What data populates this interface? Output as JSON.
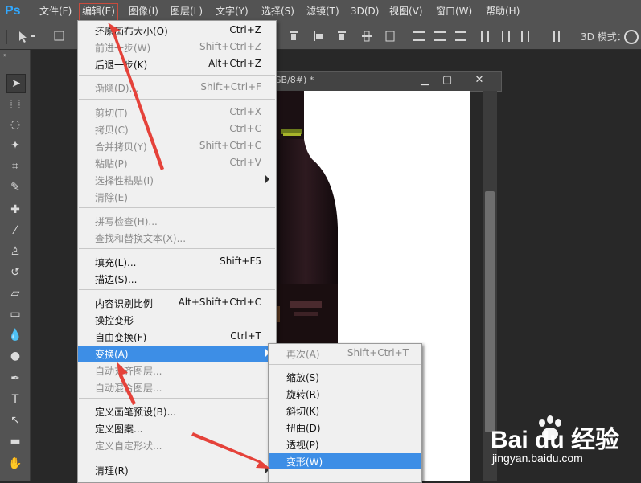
{
  "app": {
    "logo": "Ps"
  },
  "menubar": [
    {
      "label": "文件(F)"
    },
    {
      "label": "编辑(E)"
    },
    {
      "label": "图像(I)"
    },
    {
      "label": "图层(L)"
    },
    {
      "label": "文字(Y)"
    },
    {
      "label": "选择(S)"
    },
    {
      "label": "滤镜(T)"
    },
    {
      "label": "3D(D)"
    },
    {
      "label": "视图(V)"
    },
    {
      "label": "窗口(W)"
    },
    {
      "label": "帮助(H)"
    }
  ],
  "options_bar": {
    "mode_label": "3D 模式："
  },
  "document": {
    "title_fragment": "GB/8#) *"
  },
  "edit_menu": [
    {
      "label": "还原画布大小(O)",
      "shortcut": "Ctrl+Z"
    },
    {
      "label": "前进一步(W)",
      "shortcut": "Shift+Ctrl+Z"
    },
    {
      "label": "后退一步(K)",
      "shortcut": "Alt+Ctrl+Z"
    },
    {
      "label": "渐隐(D)...",
      "shortcut": "Shift+Ctrl+F"
    },
    {
      "label": "剪切(T)",
      "shortcut": "Ctrl+X"
    },
    {
      "label": "拷贝(C)",
      "shortcut": "Ctrl+C"
    },
    {
      "label": "合并拷贝(Y)",
      "shortcut": "Shift+Ctrl+C"
    },
    {
      "label": "粘贴(P)",
      "shortcut": "Ctrl+V"
    },
    {
      "label": "选择性粘贴(I)",
      "shortcut": ""
    },
    {
      "label": "清除(E)",
      "shortcut": ""
    },
    {
      "label": "拼写检查(H)...",
      "shortcut": ""
    },
    {
      "label": "查找和替换文本(X)...",
      "shortcut": ""
    },
    {
      "label": "填充(L)...",
      "shortcut": "Shift+F5"
    },
    {
      "label": "描边(S)...",
      "shortcut": ""
    },
    {
      "label": "内容识别比例",
      "shortcut": "Alt+Shift+Ctrl+C"
    },
    {
      "label": "操控变形",
      "shortcut": ""
    },
    {
      "label": "自由变换(F)",
      "shortcut": "Ctrl+T"
    },
    {
      "label": "变换(A)",
      "shortcut": ""
    },
    {
      "label": "自动对齐图层...",
      "shortcut": ""
    },
    {
      "label": "自动混合图层...",
      "shortcut": ""
    },
    {
      "label": "定义画笔预设(B)...",
      "shortcut": ""
    },
    {
      "label": "定义图案...",
      "shortcut": ""
    },
    {
      "label": "定义自定形状...",
      "shortcut": ""
    },
    {
      "label": "清理(R)",
      "shortcut": ""
    }
  ],
  "transform_submenu": [
    {
      "label": "再次(A)",
      "shortcut": "Shift+Ctrl+T"
    },
    {
      "label": "缩放(S)"
    },
    {
      "label": "旋转(R)"
    },
    {
      "label": "斜切(K)"
    },
    {
      "label": "扭曲(D)"
    },
    {
      "label": "透视(P)"
    },
    {
      "label": "变形(W)"
    }
  ],
  "watermark": {
    "brand": "Bai du 经验",
    "url": "jingyan.baidu.com"
  },
  "colors": {
    "highlight": "#3d8ee6",
    "annotation_arrow": "#e5423a"
  }
}
